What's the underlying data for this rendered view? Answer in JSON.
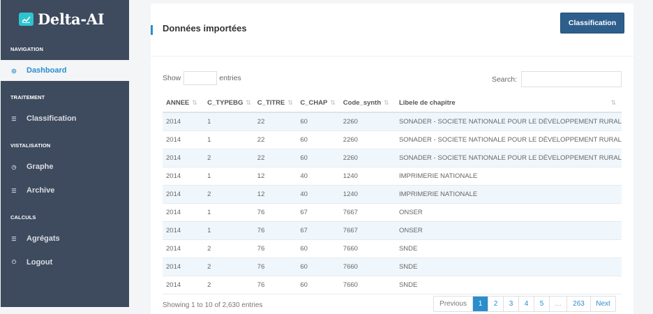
{
  "brand": {
    "name": "Delta-AI",
    "icon": "chart-line-icon",
    "accent": "#2ec4cf"
  },
  "sidebar": {
    "sections": [
      {
        "title": "NAVIGATION"
      },
      {
        "title": "TRAITEMENT"
      },
      {
        "title": "VISTALISATION"
      },
      {
        "title": "CALCULS"
      }
    ],
    "items": [
      {
        "label": "Dashboard",
        "icon": "dashboard-icon",
        "active": true
      },
      {
        "label": "Classification",
        "icon": "list-icon"
      },
      {
        "label": "Graphe",
        "icon": "clock-icon"
      },
      {
        "label": "Archive",
        "icon": "list-icon"
      },
      {
        "label": "Agrégats",
        "icon": "list-icon"
      },
      {
        "label": "Logout",
        "icon": "power-icon"
      }
    ],
    "bg_color": "#3e4a5e"
  },
  "main": {
    "title": "Données importées",
    "classification_button": "Classification",
    "show_label": "Show",
    "entries_label": "entries",
    "search_label": "Search:",
    "search_value": "",
    "columns": [
      "ANNEE",
      "C_TYPEBG",
      "C_TITRE",
      "C_CHAP",
      "Code_synth",
      "Libele de chapitre"
    ],
    "rows": [
      [
        "2014",
        "1",
        "22",
        "60",
        "2260",
        "SONADER - SOCIETE NATIONALE POUR LE DÉVELOPPEMENT RURAL"
      ],
      [
        "2014",
        "1",
        "22",
        "60",
        "2260",
        "SONADER - SOCIETE NATIONALE POUR LE DÉVELOPPEMENT RURAL"
      ],
      [
        "2014",
        "2",
        "22",
        "60",
        "2260",
        "SONADER - SOCIETE NATIONALE POUR LE DÉVELOPPEMENT RURAL"
      ],
      [
        "2014",
        "1",
        "12",
        "40",
        "1240",
        "IMPRIMERIE NATIONALE"
      ],
      [
        "2014",
        "2",
        "12",
        "40",
        "1240",
        "IMPRIMERIE NATIONALE"
      ],
      [
        "2014",
        "1",
        "76",
        "67",
        "7667",
        "ONSER"
      ],
      [
        "2014",
        "1",
        "76",
        "67",
        "7667",
        "ONSER"
      ],
      [
        "2014",
        "2",
        "76",
        "60",
        "7660",
        "SNDE"
      ],
      [
        "2014",
        "2",
        "76",
        "60",
        "7660",
        "SNDE"
      ],
      [
        "2014",
        "2",
        "76",
        "60",
        "7660",
        "SNDE"
      ]
    ],
    "info": "Showing 1 to 10 of 2,630 entries",
    "pagination": [
      "Previous",
      "1",
      "2",
      "3",
      "4",
      "5",
      "…",
      "263",
      "Next"
    ],
    "current_page": "1",
    "accent_color": "#2a8dcc",
    "button_color": "#2e5f8c"
  }
}
